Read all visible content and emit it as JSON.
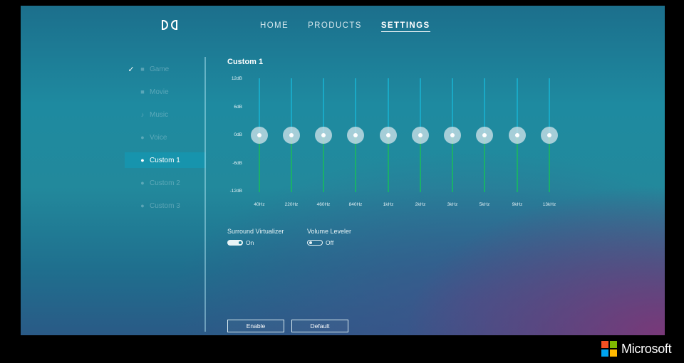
{
  "nav": {
    "items": [
      "HOME",
      "PRODUCTS",
      "SETTINGS"
    ],
    "active": "SETTINGS"
  },
  "sidebar": {
    "items": [
      {
        "label": "Game",
        "icon": "gamepad-icon",
        "checked": true,
        "active": false
      },
      {
        "label": "Movie",
        "icon": "film-icon",
        "checked": false,
        "active": false
      },
      {
        "label": "Music",
        "icon": "music-note-icon",
        "checked": false,
        "active": false
      },
      {
        "label": "Voice",
        "icon": "voice-icon",
        "checked": false,
        "active": false
      },
      {
        "label": "Custom 1",
        "icon": "person-icon",
        "checked": false,
        "active": true
      },
      {
        "label": "Custom 2",
        "icon": "person-icon",
        "checked": false,
        "active": false
      },
      {
        "label": "Custom 3",
        "icon": "person-icon",
        "checked": false,
        "active": false
      }
    ]
  },
  "equalizer": {
    "title": "Custom 1",
    "db_scale": [
      "12dB",
      "6dB",
      "0dB",
      "-6dB",
      "-12dB"
    ],
    "bands": [
      {
        "freq": "40Hz",
        "gain_db": 0
      },
      {
        "freq": "220Hz",
        "gain_db": 0
      },
      {
        "freq": "460Hz",
        "gain_db": 0
      },
      {
        "freq": "840Hz",
        "gain_db": 0
      },
      {
        "freq": "1kHz",
        "gain_db": 0
      },
      {
        "freq": "2kHz",
        "gain_db": 0
      },
      {
        "freq": "3kHz",
        "gain_db": 0
      },
      {
        "freq": "5kHz",
        "gain_db": 0
      },
      {
        "freq": "9kHz",
        "gain_db": 0
      },
      {
        "freq": "13kHz",
        "gain_db": 0
      }
    ]
  },
  "toggles": {
    "surround": {
      "label": "Surround Virtualizer",
      "state": "On"
    },
    "leveler": {
      "label": "Volume Leveler",
      "state": "Off"
    }
  },
  "buttons": {
    "enable": "Enable",
    "default": "Default"
  },
  "brand": {
    "name": "Microsoft"
  },
  "colors": {
    "active_item": "#1794ad",
    "ms_red": "#f25022",
    "ms_green": "#7fba00",
    "ms_blue": "#00a4ef",
    "ms_yellow": "#ffb900"
  }
}
